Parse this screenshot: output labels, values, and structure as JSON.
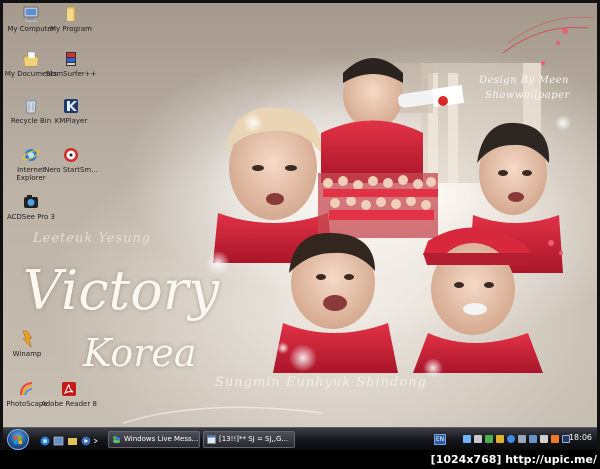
{
  "desktop_icons": [
    {
      "label": "My Computer",
      "icon": "computer-icon"
    },
    {
      "label": "My Program",
      "icon": "folder-icon"
    },
    {
      "label": "My Documents",
      "icon": "documents-icon"
    },
    {
      "label": "SlamSurfer++",
      "icon": "slamsurfer-icon"
    },
    {
      "label": "Recycle Bin",
      "icon": "recycle-bin-icon"
    },
    {
      "label": "KMPlayer",
      "icon": "kmplayer-icon"
    },
    {
      "label": "Internet Explorer",
      "icon": "internet-explorer-icon"
    },
    {
      "label": "Nero StartSm...",
      "icon": "nero-icon"
    },
    {
      "label": "ACDSee Pro 3",
      "icon": "acdsee-icon"
    },
    {
      "label": "Winamp",
      "icon": "winamp-icon"
    },
    {
      "label": "PhotoScape",
      "icon": "photoscape-icon"
    },
    {
      "label": "Adobe Reader 8",
      "icon": "adobe-reader-icon"
    }
  ],
  "wallpaper": {
    "design_credit_1": "Design By Meen",
    "design_credit_2": "Showwallpaper",
    "names_top": "Leeteuk  Yesung",
    "title_1": "Victory",
    "title_2": "Korea",
    "names_bottom": "Sungmin  Eunhyuk  Shindong",
    "colors": {
      "jersey_red": "#d8283c",
      "sepia": "#b3a89b",
      "glow": "#fff6ee"
    }
  },
  "taskbar": {
    "start_icon": "windows-orb-icon",
    "windows": [
      {
        "label": "Windows Live Mess...",
        "icon": "messenger-icon"
      },
      {
        "label": "[13!!]** SJ = SJ,,G...",
        "icon": "browser-icon"
      }
    ],
    "language": "EN",
    "clock": "18:06"
  },
  "footer": {
    "text": "[1024x768] http://upic.me/"
  }
}
